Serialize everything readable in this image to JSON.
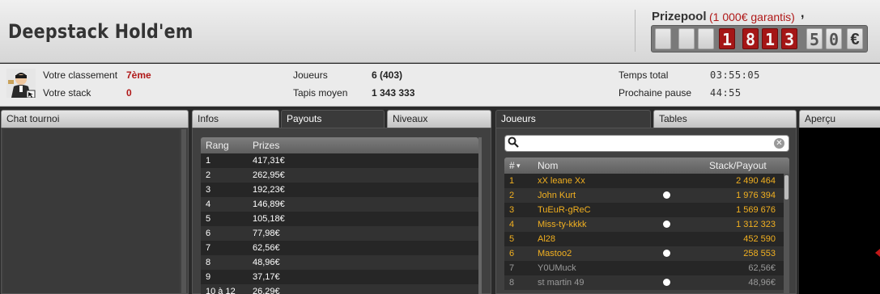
{
  "header": {
    "title": "Deepstack Hold'em",
    "prizepool_label": "Prizepool",
    "prizepool_guarantee": "(1 000€ garantis)",
    "counter": {
      "integer_digits": [
        "1",
        "8",
        "1",
        "3"
      ],
      "decimal_digits": [
        "5",
        "0"
      ],
      "separator": ",",
      "currency": "€"
    }
  },
  "info": {
    "rank_label": "Votre classement",
    "rank_value": "7ème",
    "stack_label": "Votre stack",
    "stack_value": "0",
    "players_label": "Joueurs",
    "players_value": "6 (403)",
    "avg_stack_label": "Tapis moyen",
    "avg_stack_value": "1 343 333",
    "total_time_label": "Temps total",
    "total_time_value": "03:55:05",
    "next_break_label": "Prochaine pause",
    "next_break_value": "44:55"
  },
  "chat": {
    "tab_label": "Chat tournoi"
  },
  "payouts": {
    "tabs": [
      {
        "label": "Infos",
        "active": false
      },
      {
        "label": "Payouts",
        "active": true
      },
      {
        "label": "Niveaux",
        "active": false
      }
    ],
    "columns": {
      "rank": "Rang",
      "prize": "Prizes"
    },
    "rows": [
      {
        "rank": "1",
        "prize": "417,31€"
      },
      {
        "rank": "2",
        "prize": "262,95€"
      },
      {
        "rank": "3",
        "prize": "192,23€"
      },
      {
        "rank": "4",
        "prize": "146,89€"
      },
      {
        "rank": "5",
        "prize": "105,18€"
      },
      {
        "rank": "6",
        "prize": "77,98€"
      },
      {
        "rank": "7",
        "prize": "62,56€"
      },
      {
        "rank": "8",
        "prize": "48,96€"
      },
      {
        "rank": "9",
        "prize": "37,17€"
      },
      {
        "rank": "10 à 12",
        "prize": "26,29€"
      }
    ]
  },
  "players": {
    "tabs": [
      {
        "label": "Joueurs",
        "active": true
      },
      {
        "label": "Tables",
        "active": false
      }
    ],
    "search_value": "",
    "clear_glyph": "✕",
    "sort_glyph": "▾",
    "columns": {
      "num": "#",
      "name": "Nom",
      "stack": "Stack/Payout"
    },
    "rows": [
      {
        "num": "1",
        "name": "xX leane Xx",
        "stack": "2 490 464",
        "status_dot": false,
        "eliminated": false
      },
      {
        "num": "2",
        "name": "John Kurt",
        "stack": "1 976 394",
        "status_dot": true,
        "eliminated": false
      },
      {
        "num": "3",
        "name": "TuEuR-gReC",
        "stack": "1 569 676",
        "status_dot": false,
        "eliminated": false
      },
      {
        "num": "4",
        "name": "Miss-ty-kkkk",
        "stack": "1 312 323",
        "status_dot": true,
        "eliminated": false
      },
      {
        "num": "5",
        "name": "Al28",
        "stack": "452 590",
        "status_dot": false,
        "eliminated": false
      },
      {
        "num": "6",
        "name": "Mastoo2",
        "stack": "258 553",
        "status_dot": true,
        "eliminated": false
      },
      {
        "num": "7",
        "name": "Y0UMuck",
        "stack": "62,56€",
        "status_dot": false,
        "eliminated": true
      },
      {
        "num": "8",
        "name": "st martin 49",
        "stack": "48,96€",
        "status_dot": true,
        "eliminated": true
      }
    ]
  },
  "preview": {
    "tab_label": "Aperçu"
  }
}
